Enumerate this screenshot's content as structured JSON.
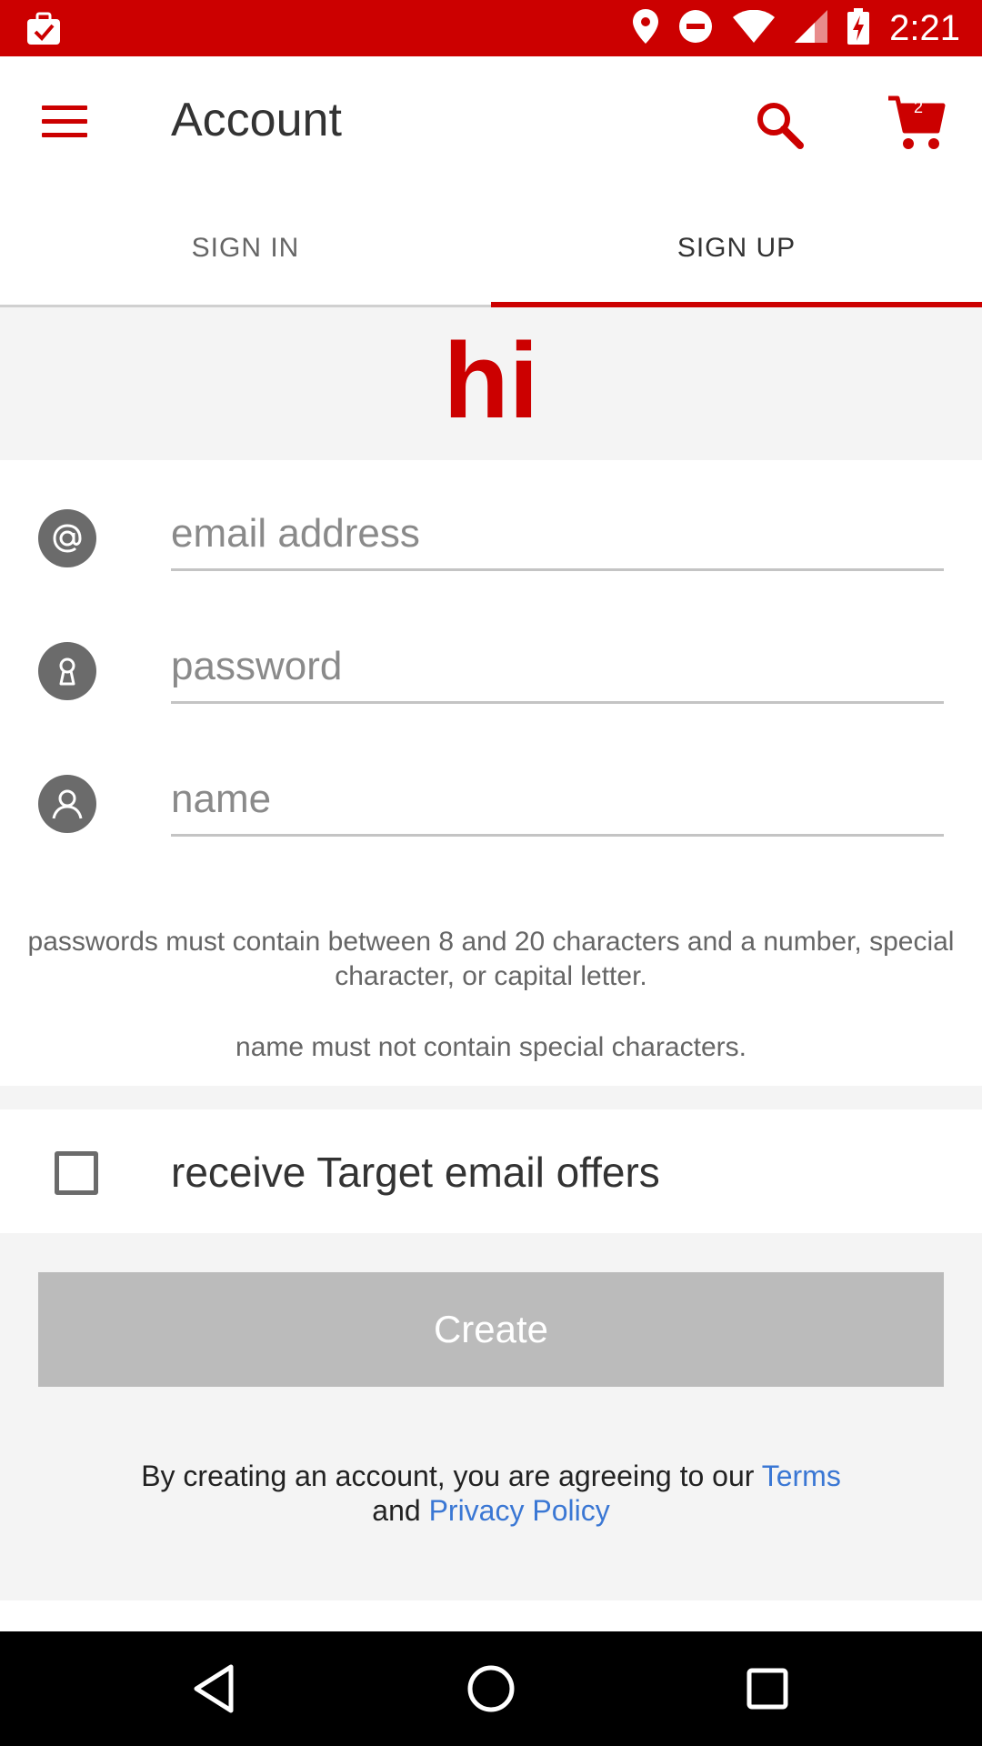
{
  "status_bar": {
    "time": "2:21",
    "icons": [
      "clipboard-check-icon",
      "location-icon",
      "do-not-disturb-icon",
      "wifi-icon",
      "cell-signal-icon",
      "battery-charging-icon"
    ]
  },
  "app_bar": {
    "title": "Account",
    "cart_count": "2",
    "icons": [
      "menu-icon",
      "search-icon",
      "cart-icon"
    ]
  },
  "tabs": [
    {
      "label": "SIGN IN",
      "active": false
    },
    {
      "label": "SIGN UP",
      "active": true
    }
  ],
  "banner": {
    "text": "hi"
  },
  "form": {
    "email": {
      "placeholder": "email address",
      "value": "",
      "icon": "at-sign-icon"
    },
    "password": {
      "placeholder": "password",
      "value": "",
      "icon": "keyhole-icon"
    },
    "name": {
      "placeholder": "name",
      "value": "",
      "icon": "person-icon"
    }
  },
  "hints": {
    "password_rule": "passwords must contain between 8 and 20 characters and a number, special character, or capital letter.",
    "name_rule": "name must not contain special characters."
  },
  "offers": {
    "label": "receive Target email offers",
    "checked": false
  },
  "create_button": {
    "label": "Create"
  },
  "legal": {
    "prefix": "By creating an account, you are agreeing to our ",
    "terms_link": "Terms",
    "and": "and ",
    "privacy_link": "Privacy Policy"
  },
  "colors": {
    "brand_red": "#cc0000",
    "link_blue": "#3a77d4",
    "disabled_button": "#bbbbbb"
  },
  "nav_bar": {
    "icons": [
      "back-icon",
      "home-icon",
      "recents-icon"
    ]
  }
}
